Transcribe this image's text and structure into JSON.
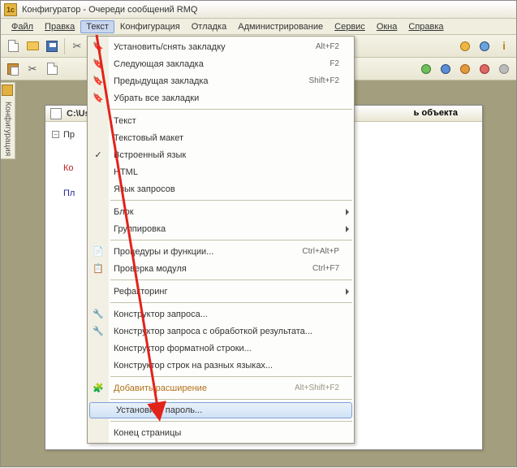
{
  "window": {
    "title": "Конфигуратор - Очереди сообщений RMQ",
    "inner_title": "C:\\Us",
    "object_label": "ь объекта",
    "sidebar_tab": "Конфигурация"
  },
  "menubar": {
    "file": "Файл",
    "edit": "Правка",
    "text": "Текст",
    "config": "Конфигурация",
    "debug": "Отладка",
    "admin": "Администрирование",
    "service": "Сервис",
    "windows": "Окна",
    "help": "Справка"
  },
  "tree": {
    "item1": "Пр",
    "item2": "Ко",
    "item3": "Пл"
  },
  "dropdown": {
    "set_bookmark": "Установить/снять закладку",
    "set_bookmark_sc": "Alt+F2",
    "next_bookmark": "Следующая закладка",
    "next_bookmark_sc": "F2",
    "prev_bookmark": "Предыдущая закладка",
    "prev_bookmark_sc": "Shift+F2",
    "clear_bookmarks": "Убрать все закладки",
    "text": "Текст",
    "text_layout": "Текстовый макет",
    "builtin_lang": "Встроенный язык",
    "html": "HTML",
    "query_lang": "Язык запросов",
    "block": "Блок",
    "grouping": "Группировка",
    "procs": "Процедуры и функции...",
    "procs_sc": "Ctrl+Alt+P",
    "check_module": "Проверка модуля",
    "check_module_sc": "Ctrl+F7",
    "refactoring": "Рефакторинг",
    "query_ctor": "Конструктор запроса...",
    "query_ctor_res": "Конструктор запроса с обработкой результата...",
    "fmt_ctor": "Конструктор форматной строки...",
    "multilang_ctor": "Конструктор строк на разных языках...",
    "add_ext": "Добавить расширение",
    "add_ext_sc": "Alt+Shift+F2",
    "set_password": "Установить пароль...",
    "page_end": "Конец страницы"
  }
}
